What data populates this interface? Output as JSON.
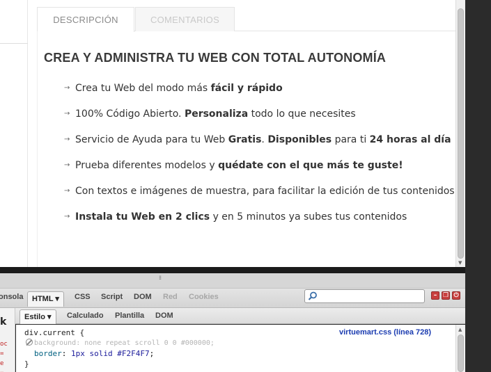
{
  "page": {
    "tabs": [
      {
        "label": "DESCRIPCIÓN",
        "active": true
      },
      {
        "label": "COMENTARIOS",
        "active": false
      }
    ],
    "heading": "CREA Y ADMINISTRA TU WEB CON TOTAL AUTONOMÍA",
    "features": [
      [
        {
          "t": "Crea tu Web del modo más "
        },
        {
          "t": "fácil y rápido",
          "b": true
        }
      ],
      [
        {
          "t": "100% Código Abierto. "
        },
        {
          "t": "Personaliza",
          "b": true
        },
        {
          "t": " todo lo que necesites"
        }
      ],
      [
        {
          "t": "Servicio de Ayuda para tu Web "
        },
        {
          "t": "Gratis",
          "b": true
        },
        {
          "t": ". "
        },
        {
          "t": "Disponibles",
          "b": true
        },
        {
          "t": " para ti "
        },
        {
          "t": "24 horas al día",
          "b": true
        }
      ],
      [
        {
          "t": "Prueba diferentes modelos y "
        },
        {
          "t": "quédate con el que más te guste!",
          "b": true
        }
      ],
      [
        {
          "t": "Con textos e imágenes de muestra, para facilitar la edición de tus contenidos"
        }
      ],
      [
        {
          "t": "Instala tu Web en 2 clics",
          "b": true
        },
        {
          "t": " y en 5 minutos ya subes tus contenidos"
        }
      ]
    ],
    "arrow_glyph": "→"
  },
  "firebug": {
    "panels": [
      {
        "label": "onsola",
        "disabled": false
      },
      {
        "label": "HTML ▾",
        "disabled": false,
        "selected": true
      },
      {
        "label": "CSS",
        "disabled": false
      },
      {
        "label": "Script",
        "disabled": false
      },
      {
        "label": "DOM",
        "disabled": false
      },
      {
        "label": "Red",
        "disabled": true
      },
      {
        "label": "Cookies",
        "disabled": true
      }
    ],
    "search_value": "",
    "window_buttons": [
      "–",
      "❐",
      "⏻"
    ],
    "subpanels": [
      {
        "label": "Estilo ▾",
        "selected": true
      },
      {
        "label": "Calculado"
      },
      {
        "label": "Plantilla"
      },
      {
        "label": "DOM"
      }
    ],
    "gutter_arrow": "k",
    "gutter_lines": [
      "oc",
      "=",
      "e",
      "="
    ],
    "css": {
      "selector": "div.current {",
      "source": "virtuemart.css (línea 728)",
      "disabled_rule": "background: none repeat scroll 0 0 #000000;",
      "prop_name": "border",
      "prop_value": "1px solid #F2F4F7",
      "close": "}"
    }
  },
  "colors": {
    "accent_source_link": "#1a3bb0",
    "window_button": "#c8403f",
    "css_value": "#1a1a9a",
    "css_prop": "#006080"
  }
}
